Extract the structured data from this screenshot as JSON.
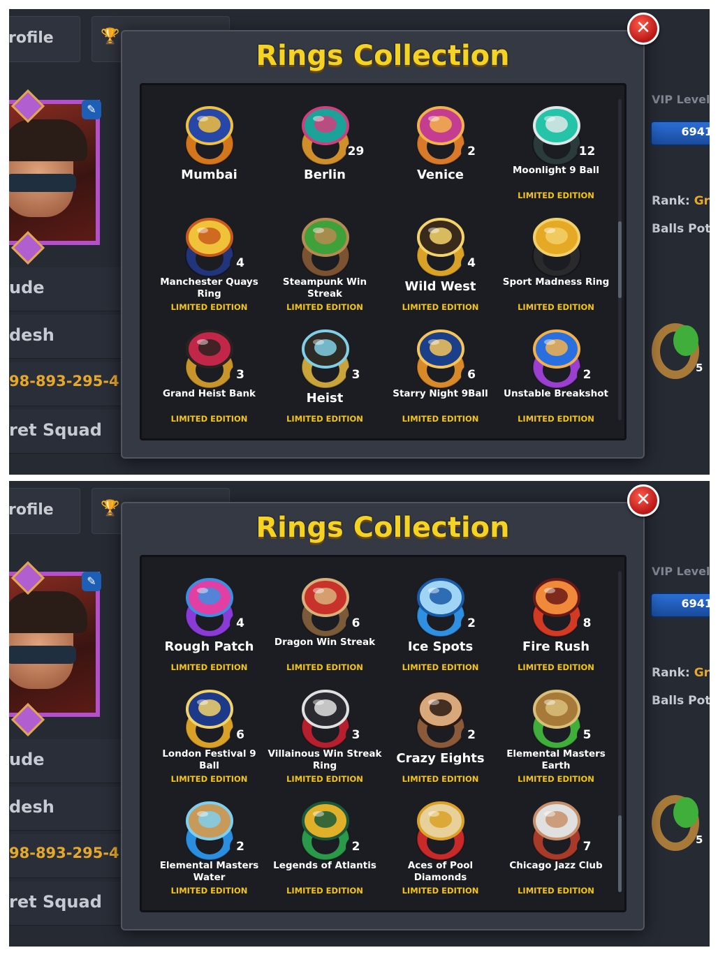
{
  "background": {
    "profile_tab": "rofile",
    "rows": [
      "ude",
      "desh",
      "98-893-295-4",
      "ret Squad"
    ],
    "vip_label": "VIP Level:",
    "vip_value": "6941",
    "rank_label": "Rank:",
    "rank_value": "Gra",
    "balls_label": "Balls Potte",
    "side_ring_count": "5"
  },
  "screens": [
    {
      "title": "Rings Collection",
      "close_label": "✕",
      "scroll_position": 0.5,
      "rings": [
        {
          "name": "Mumbai",
          "count": "",
          "edition": "",
          "colors": [
            "#d4761c",
            "#2747a8",
            "#f0c040"
          ]
        },
        {
          "name": "Berlin",
          "count": "29",
          "edition": "",
          "colors": [
            "#cf8f2b",
            "#1ba39a",
            "#d23e7c"
          ]
        },
        {
          "name": "Venice",
          "count": "2",
          "edition": "",
          "colors": [
            "#d97a2a",
            "#c43d91",
            "#f2b24b"
          ]
        },
        {
          "name": "Moonlight 9 Ball",
          "count": "12",
          "edition": "LIMITED EDITION",
          "colors": [
            "#2b3a3a",
            "#25c4a8",
            "#dfe6e6"
          ]
        },
        {
          "name": "Manchester Quays Ring",
          "count": "4",
          "edition": "LIMITED EDITION",
          "colors": [
            "#22357a",
            "#f0c23a",
            "#c95a1d"
          ]
        },
        {
          "name": "Steampunk Win Streak",
          "count": "",
          "edition": "LIMITED EDITION",
          "colors": [
            "#7b5333",
            "#3fa13a",
            "#b78a52"
          ]
        },
        {
          "name": "Wild West",
          "count": "4",
          "edition": "LIMITED EDITION",
          "colors": [
            "#d9a227",
            "#3a2a1c",
            "#f4d36b"
          ]
        },
        {
          "name": "Sport Madness Ring",
          "count": "",
          "edition": "LIMITED EDITION",
          "colors": [
            "#2a2a2c",
            "#e6a925",
            "#f1d06a"
          ]
        },
        {
          "name": "Grand Heist Bank",
          "count": "3",
          "edition": "LIMITED EDITION",
          "colors": [
            "#c9952a",
            "#c2274a",
            "#2a2320"
          ]
        },
        {
          "name": "Heist",
          "count": "3",
          "edition": "LIMITED EDITION",
          "colors": [
            "#c9a43a",
            "#2e2a26",
            "#7fd0e6"
          ]
        },
        {
          "name": "Starry Night 9Ball",
          "count": "6",
          "edition": "LIMITED EDITION",
          "colors": [
            "#d98a28",
            "#1c3f8a",
            "#f3c55b"
          ]
        },
        {
          "name": "Unstable Breakshot",
          "count": "2",
          "edition": "LIMITED EDITION",
          "colors": [
            "#9a3fd0",
            "#2a6fe0",
            "#f2b24b"
          ]
        }
      ]
    },
    {
      "title": "Rings Collection",
      "close_label": "✕",
      "scroll_position": 1.0,
      "rings": [
        {
          "name": "Rough Patch",
          "count": "4",
          "edition": "LIMITED EDITION",
          "colors": [
            "#8a3ad6",
            "#e23fa4",
            "#3b8fe0"
          ]
        },
        {
          "name": "Dragon Win Streak",
          "count": "6",
          "edition": "LIMITED EDITION",
          "colors": [
            "#7b5a3a",
            "#c8322a",
            "#d8b07a"
          ]
        },
        {
          "name": "Ice Spots",
          "count": "2",
          "edition": "LIMITED EDITION",
          "colors": [
            "#2f8fe0",
            "#9fd4f5",
            "#1a5aa8"
          ]
        },
        {
          "name": "Fire Rush",
          "count": "8",
          "edition": "LIMITED EDITION",
          "colors": [
            "#d23a24",
            "#f08a3a",
            "#6a1a16"
          ]
        },
        {
          "name": "London Festival 9 Ball",
          "count": "6",
          "edition": "LIMITED EDITION",
          "colors": [
            "#d9a227",
            "#1d3a8a",
            "#f2d36a"
          ]
        },
        {
          "name": "Villainous Win Streak Ring",
          "count": "3",
          "edition": "LIMITED EDITION",
          "colors": [
            "#b51f2e",
            "#2a2a30",
            "#e0e0e0"
          ]
        },
        {
          "name": "Crazy Eights",
          "count": "2",
          "edition": "LIMITED EDITION",
          "colors": [
            "#8a5a3a",
            "#d9a87a",
            "#2a1a14"
          ]
        },
        {
          "name": "Elemental Masters Earth",
          "count": "5",
          "edition": "LIMITED EDITION",
          "colors": [
            "#3fae3a",
            "#a87a3a",
            "#d8c07a"
          ]
        },
        {
          "name": "Elemental Masters Water",
          "count": "2",
          "edition": "LIMITED EDITION",
          "colors": [
            "#2a8fe0",
            "#c89a5a",
            "#7fd0f0"
          ]
        },
        {
          "name": "Legends of Atlantis",
          "count": "2",
          "edition": "LIMITED EDITION",
          "colors": [
            "#2a9a4a",
            "#e0b02a",
            "#1a5a3a"
          ]
        },
        {
          "name": "Aces of Pool Diamonds",
          "count": "",
          "edition": "LIMITED EDITION",
          "colors": [
            "#c82a2a",
            "#e8d09a",
            "#d9a227"
          ]
        },
        {
          "name": "Chicago Jazz Club",
          "count": "7",
          "edition": "LIMITED EDITION",
          "colors": [
            "#a83a2a",
            "#e0e0e0",
            "#c8906a"
          ]
        }
      ]
    }
  ]
}
